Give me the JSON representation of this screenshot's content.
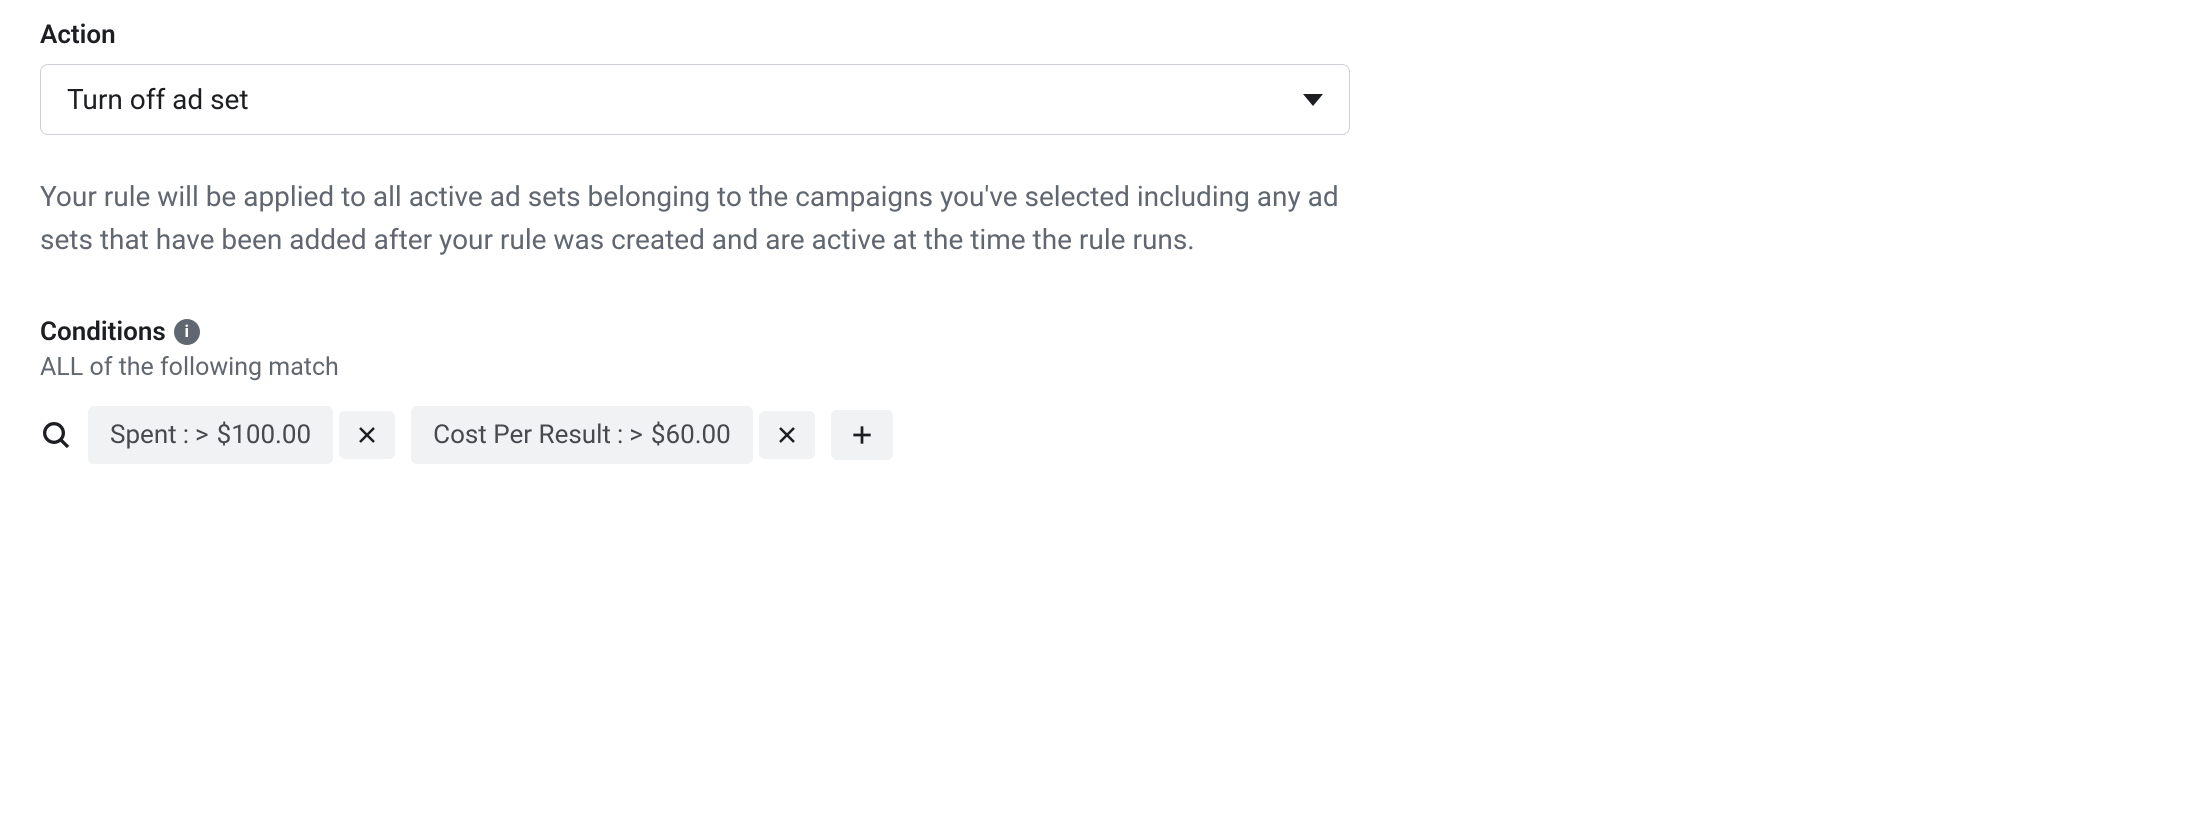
{
  "action": {
    "label": "Action",
    "selected": "Turn off ad set"
  },
  "description": "Your rule will be applied to all active ad sets belonging to the campaigns you've selected including any ad sets that have been added after your rule was created and are active at the time the rule runs.",
  "conditions": {
    "label": "Conditions",
    "subtitle": "ALL of the following match",
    "items": [
      {
        "metric": "Spent",
        "operator": ">",
        "value": "$100.00"
      },
      {
        "metric": "Cost Per Result",
        "operator": ">",
        "value": "$60.00"
      }
    ]
  }
}
